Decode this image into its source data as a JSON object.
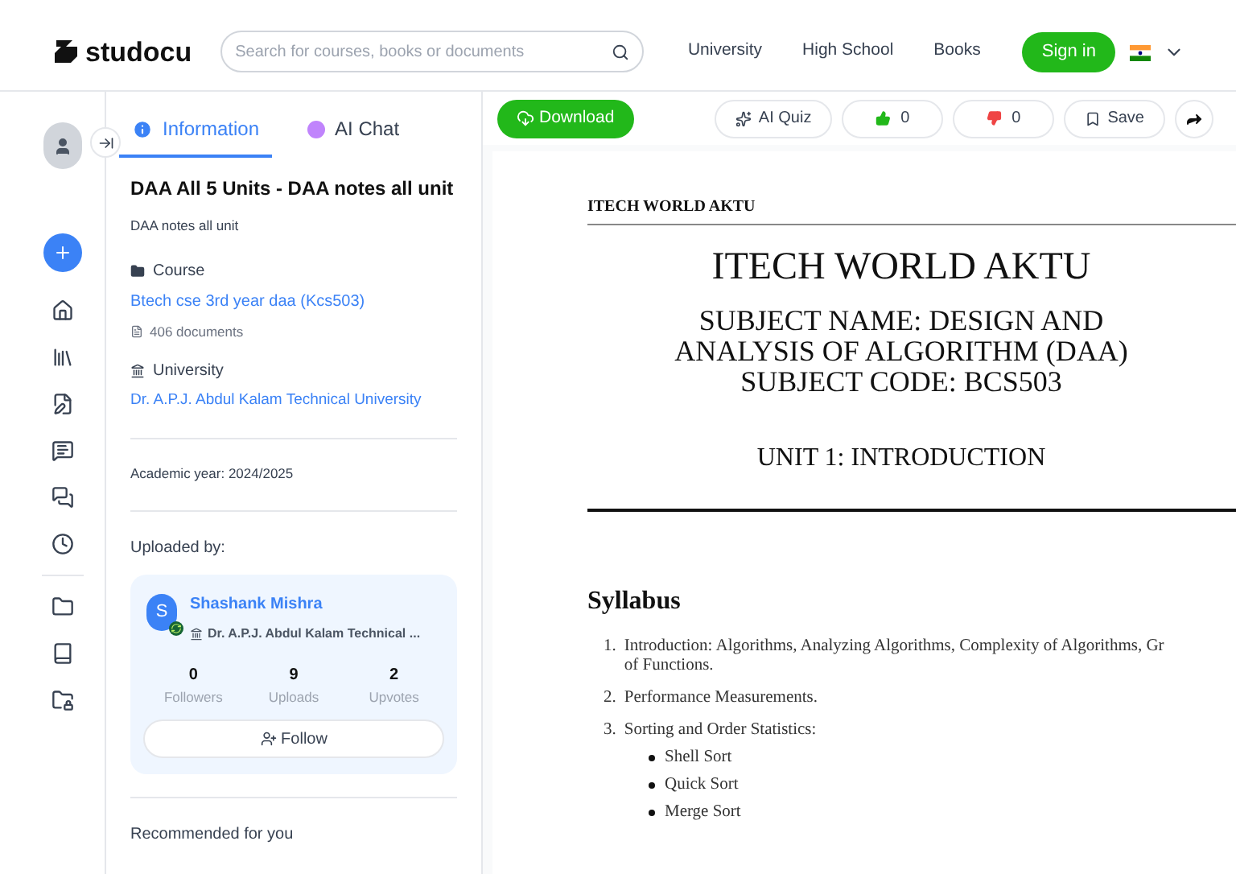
{
  "header": {
    "logo": "studocu",
    "search": {
      "placeholder": "Search for courses, books or documents"
    },
    "nav": [
      "University",
      "High School",
      "Books"
    ],
    "sign_in": "Sign in"
  },
  "tabs": [
    {
      "label": "Information",
      "kind": "info",
      "selected": true
    },
    {
      "label": "AI Chat",
      "kind": "chat",
      "selected": false
    }
  ],
  "info": {
    "title": "DAA All 5 Units - DAA notes all unit",
    "description": "DAA notes all unit",
    "course": {
      "heading": "Course",
      "name": "Btech cse 3rd year daa (Kcs503)",
      "count": "406 documents"
    },
    "university": {
      "heading": "University",
      "name": "Dr. A.P.J. Abdul Kalam Technical University"
    },
    "academic_year": "Academic year: 2024/2025",
    "uploaded_by": "Uploaded by:",
    "uploader": {
      "initial": "S",
      "name": "Shashank Mishra",
      "institution": "Dr. A.P.J. Abdul Kalam Technical ...",
      "stats": [
        {
          "value": "0",
          "label": "Followers"
        },
        {
          "value": "9",
          "label": "Uploads"
        },
        {
          "value": "2",
          "label": "Upvotes"
        }
      ],
      "follow": "Follow"
    },
    "recommended": "Recommended for you"
  },
  "toolbar": {
    "download": "Download",
    "ai_quiz": "AI Quiz",
    "likes": "0",
    "dislikes": "0",
    "save": "Save"
  },
  "document": {
    "running_head": "ITECH WORLD AKTU",
    "title": "ITECH WORLD AKTU",
    "subject": [
      "SUBJECT NAME: DESIGN AND",
      "ANALYSIS OF ALGORITHM (DAA)",
      "SUBJECT CODE: BCS503"
    ],
    "unit": "UNIT 1: INTRODUCTION",
    "syllabus_heading": "Syllabus",
    "syllabus": [
      {
        "number": "1.",
        "lines": [
          "Introduction: Algorithms, Analyzing Algorithms, Complexity of Algorithms, Gr",
          "of Functions."
        ]
      },
      {
        "number": "2.",
        "lines": [
          "Performance Measurements."
        ]
      },
      {
        "number": "3.",
        "lines": [
          "Sorting and Order Statistics:"
        ],
        "sub": [
          "Shell Sort",
          "Quick Sort",
          "Merge Sort"
        ]
      }
    ]
  }
}
